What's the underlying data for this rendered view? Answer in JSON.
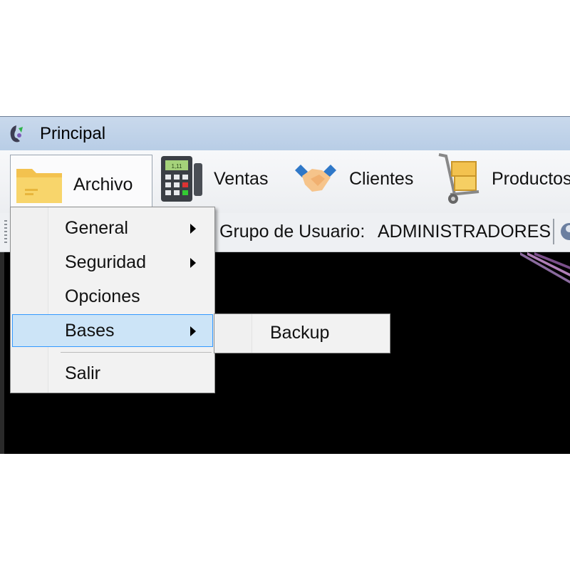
{
  "window": {
    "title": "Principal"
  },
  "toolbar": {
    "items": [
      {
        "label": "Archivo",
        "icon": "folder-icon"
      },
      {
        "label": "Ventas",
        "icon": "cash-register-icon"
      },
      {
        "label": "Clientes",
        "icon": "handshake-icon"
      },
      {
        "label": "Productos",
        "icon": "hand-truck-icon"
      }
    ]
  },
  "status": {
    "group_label": "Grupo de Usuario:",
    "group_value": "ADMINISTRADORES"
  },
  "menu": {
    "items": [
      {
        "label": "General",
        "has_submenu": true
      },
      {
        "label": "Seguridad",
        "has_submenu": true
      },
      {
        "label": "Opciones",
        "has_submenu": false
      },
      {
        "label": "Bases",
        "has_submenu": true,
        "highlighted": true
      },
      {
        "label": "Salir",
        "has_submenu": false
      }
    ]
  },
  "submenu": {
    "items": [
      {
        "label": "Backup"
      }
    ]
  },
  "colors": {
    "titlebar": "#c3d5ea",
    "menu_highlight": "#cce4f7",
    "menu_highlight_border": "#3399ff",
    "content_background": "#000000"
  }
}
